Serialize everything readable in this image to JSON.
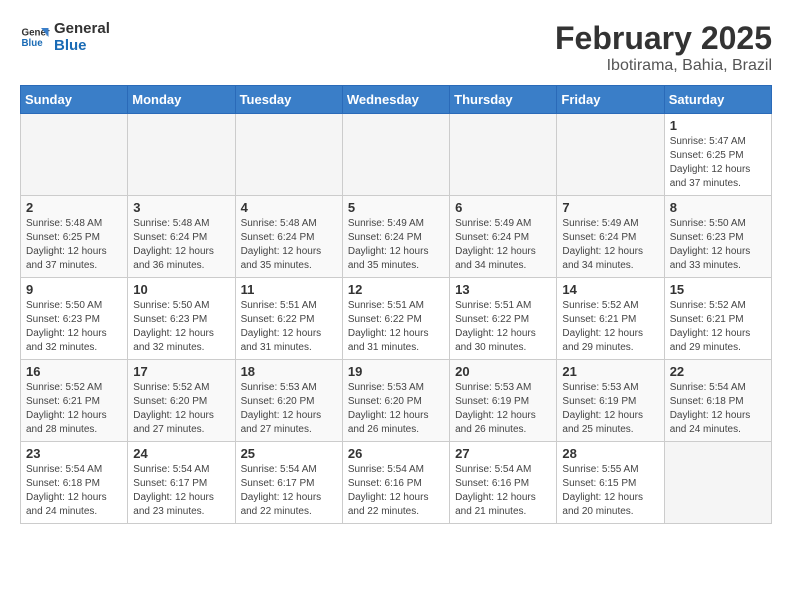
{
  "logo": {
    "line1": "General",
    "line2": "Blue"
  },
  "title": "February 2025",
  "subtitle": "Ibotirama, Bahia, Brazil",
  "weekdays": [
    "Sunday",
    "Monday",
    "Tuesday",
    "Wednesday",
    "Thursday",
    "Friday",
    "Saturday"
  ],
  "weeks": [
    [
      {
        "day": "",
        "info": ""
      },
      {
        "day": "",
        "info": ""
      },
      {
        "day": "",
        "info": ""
      },
      {
        "day": "",
        "info": ""
      },
      {
        "day": "",
        "info": ""
      },
      {
        "day": "",
        "info": ""
      },
      {
        "day": "1",
        "info": "Sunrise: 5:47 AM\nSunset: 6:25 PM\nDaylight: 12 hours\nand 37 minutes."
      }
    ],
    [
      {
        "day": "2",
        "info": "Sunrise: 5:48 AM\nSunset: 6:25 PM\nDaylight: 12 hours\nand 37 minutes."
      },
      {
        "day": "3",
        "info": "Sunrise: 5:48 AM\nSunset: 6:24 PM\nDaylight: 12 hours\nand 36 minutes."
      },
      {
        "day": "4",
        "info": "Sunrise: 5:48 AM\nSunset: 6:24 PM\nDaylight: 12 hours\nand 35 minutes."
      },
      {
        "day": "5",
        "info": "Sunrise: 5:49 AM\nSunset: 6:24 PM\nDaylight: 12 hours\nand 35 minutes."
      },
      {
        "day": "6",
        "info": "Sunrise: 5:49 AM\nSunset: 6:24 PM\nDaylight: 12 hours\nand 34 minutes."
      },
      {
        "day": "7",
        "info": "Sunrise: 5:49 AM\nSunset: 6:24 PM\nDaylight: 12 hours\nand 34 minutes."
      },
      {
        "day": "8",
        "info": "Sunrise: 5:50 AM\nSunset: 6:23 PM\nDaylight: 12 hours\nand 33 minutes."
      }
    ],
    [
      {
        "day": "9",
        "info": "Sunrise: 5:50 AM\nSunset: 6:23 PM\nDaylight: 12 hours\nand 32 minutes."
      },
      {
        "day": "10",
        "info": "Sunrise: 5:50 AM\nSunset: 6:23 PM\nDaylight: 12 hours\nand 32 minutes."
      },
      {
        "day": "11",
        "info": "Sunrise: 5:51 AM\nSunset: 6:22 PM\nDaylight: 12 hours\nand 31 minutes."
      },
      {
        "day": "12",
        "info": "Sunrise: 5:51 AM\nSunset: 6:22 PM\nDaylight: 12 hours\nand 31 minutes."
      },
      {
        "day": "13",
        "info": "Sunrise: 5:51 AM\nSunset: 6:22 PM\nDaylight: 12 hours\nand 30 minutes."
      },
      {
        "day": "14",
        "info": "Sunrise: 5:52 AM\nSunset: 6:21 PM\nDaylight: 12 hours\nand 29 minutes."
      },
      {
        "day": "15",
        "info": "Sunrise: 5:52 AM\nSunset: 6:21 PM\nDaylight: 12 hours\nand 29 minutes."
      }
    ],
    [
      {
        "day": "16",
        "info": "Sunrise: 5:52 AM\nSunset: 6:21 PM\nDaylight: 12 hours\nand 28 minutes."
      },
      {
        "day": "17",
        "info": "Sunrise: 5:52 AM\nSunset: 6:20 PM\nDaylight: 12 hours\nand 27 minutes."
      },
      {
        "day": "18",
        "info": "Sunrise: 5:53 AM\nSunset: 6:20 PM\nDaylight: 12 hours\nand 27 minutes."
      },
      {
        "day": "19",
        "info": "Sunrise: 5:53 AM\nSunset: 6:20 PM\nDaylight: 12 hours\nand 26 minutes."
      },
      {
        "day": "20",
        "info": "Sunrise: 5:53 AM\nSunset: 6:19 PM\nDaylight: 12 hours\nand 26 minutes."
      },
      {
        "day": "21",
        "info": "Sunrise: 5:53 AM\nSunset: 6:19 PM\nDaylight: 12 hours\nand 25 minutes."
      },
      {
        "day": "22",
        "info": "Sunrise: 5:54 AM\nSunset: 6:18 PM\nDaylight: 12 hours\nand 24 minutes."
      }
    ],
    [
      {
        "day": "23",
        "info": "Sunrise: 5:54 AM\nSunset: 6:18 PM\nDaylight: 12 hours\nand 24 minutes."
      },
      {
        "day": "24",
        "info": "Sunrise: 5:54 AM\nSunset: 6:17 PM\nDaylight: 12 hours\nand 23 minutes."
      },
      {
        "day": "25",
        "info": "Sunrise: 5:54 AM\nSunset: 6:17 PM\nDaylight: 12 hours\nand 22 minutes."
      },
      {
        "day": "26",
        "info": "Sunrise: 5:54 AM\nSunset: 6:16 PM\nDaylight: 12 hours\nand 22 minutes."
      },
      {
        "day": "27",
        "info": "Sunrise: 5:54 AM\nSunset: 6:16 PM\nDaylight: 12 hours\nand 21 minutes."
      },
      {
        "day": "28",
        "info": "Sunrise: 5:55 AM\nSunset: 6:15 PM\nDaylight: 12 hours\nand 20 minutes."
      },
      {
        "day": "",
        "info": ""
      }
    ]
  ]
}
